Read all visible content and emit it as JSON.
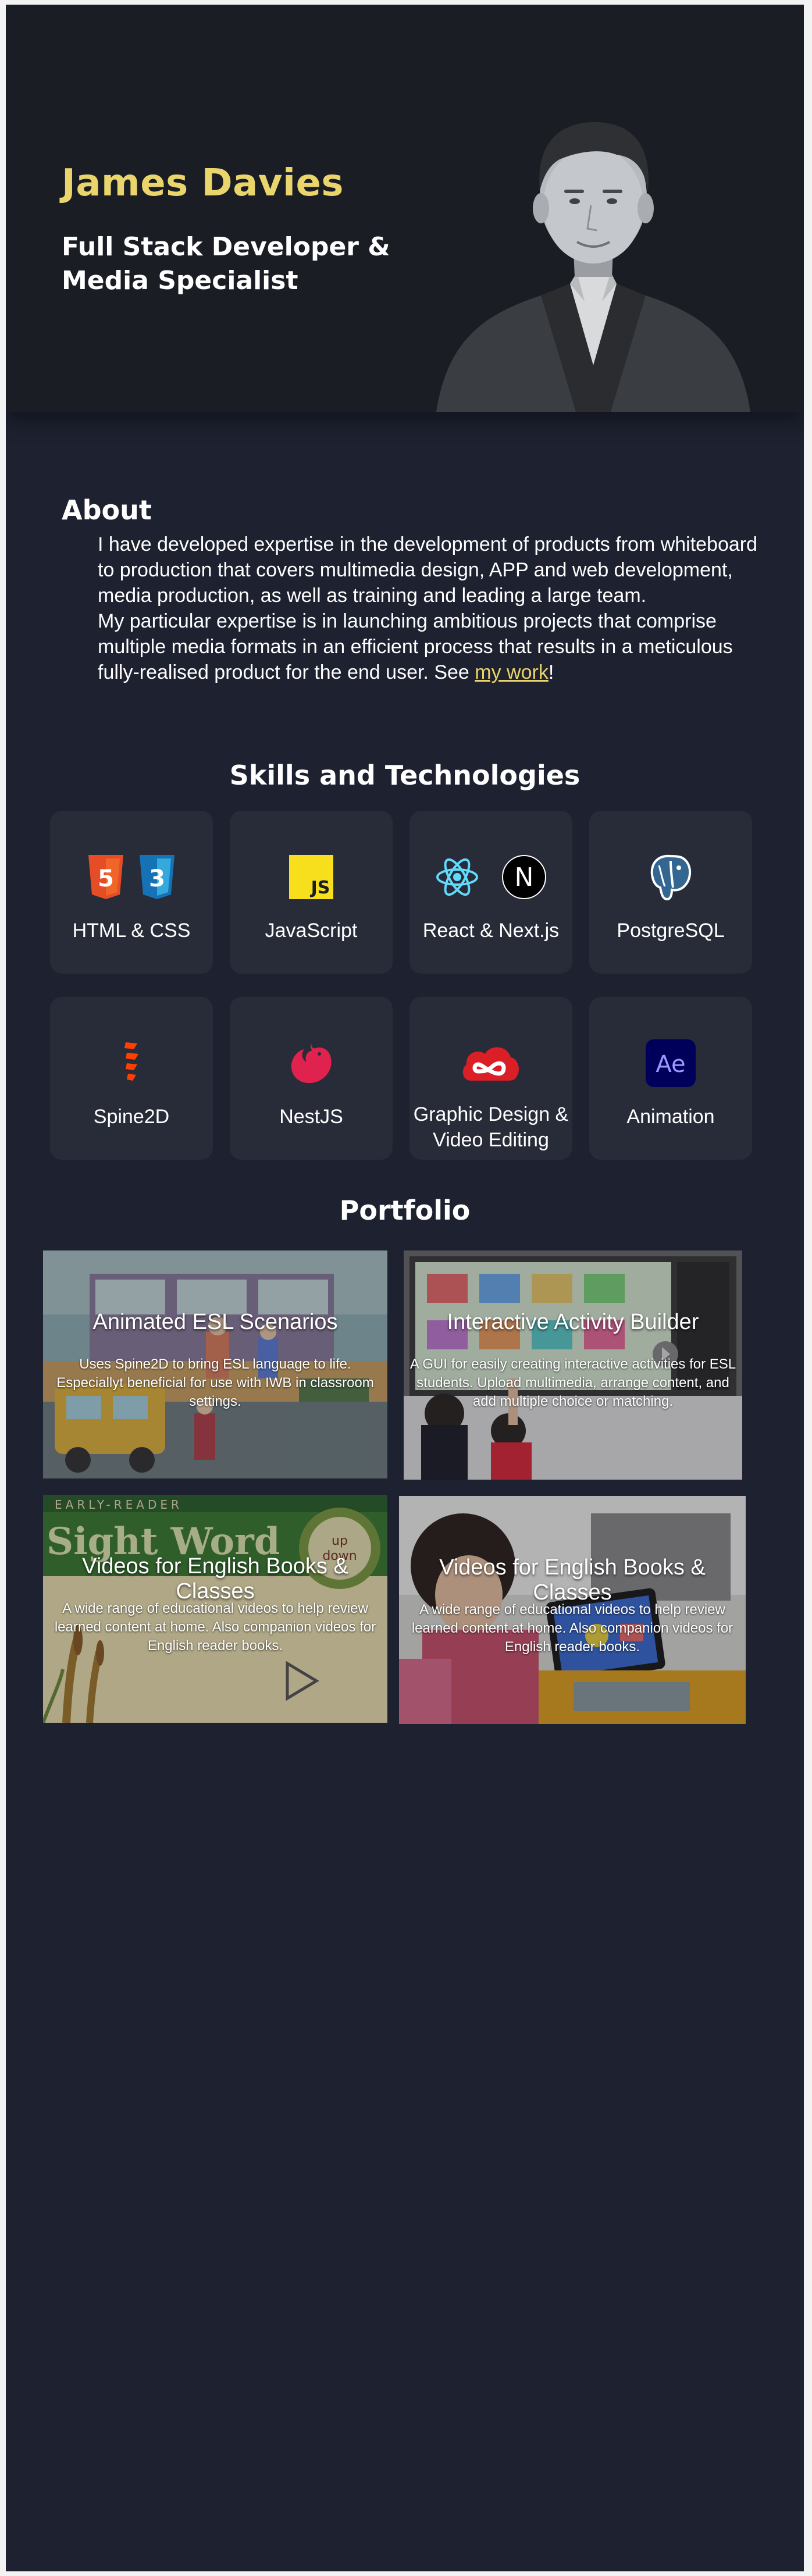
{
  "hero": {
    "name": "James Davies",
    "title": "Full Stack Developer & Media Specialist"
  },
  "about": {
    "heading": "About",
    "paragraph1": "I have developed expertise in the development of products from whiteboard to production that covers multimedia design, APP and web development, media production, as well as training and leading a large team.",
    "paragraph2_before": "My particular expertise is in launching ambitious projects that comprise multiple media formats in an efficient process that results in a meticulous fully-realised product for the end user. See ",
    "link": "my work",
    "paragraph2_after": "!"
  },
  "skills": {
    "heading": "Skills and Technologies",
    "items": [
      {
        "label": "HTML & CSS",
        "icons": [
          "html5-icon",
          "css3-icon"
        ]
      },
      {
        "label": "JavaScript",
        "icons": [
          "javascript-icon"
        ]
      },
      {
        "label": "React & Next.js",
        "icons": [
          "react-icon",
          "nextjs-icon"
        ]
      },
      {
        "label": "PostgreSQL",
        "icons": [
          "postgresql-icon"
        ]
      },
      {
        "label": "Spine2D",
        "icons": [
          "spine2d-icon"
        ]
      },
      {
        "label": "NestJS",
        "icons": [
          "nestjs-icon"
        ]
      },
      {
        "label": "Graphic Design & Video Editing",
        "icons": [
          "creative-cloud-icon"
        ]
      },
      {
        "label": "Animation",
        "icons": [
          "after-effects-icon"
        ]
      }
    ]
  },
  "icon_text": {
    "html": "5",
    "css": "3",
    "js": "JS",
    "next": "N",
    "ae": "Ae"
  },
  "portfolio": {
    "heading": "Portfolio",
    "items": [
      {
        "title": "Animated ESL Scenarios",
        "description": "Uses Spine2D to bring ESL language to life. Especiallyt beneficial for use with IWB in classroom settings."
      },
      {
        "title": "Interactive Activity Builder",
        "description": "A GUI for easily creating interactive activities for ESL students. Upload multimedia, arrange content, and add multiple choice or matching."
      },
      {
        "title": "Videos for English Books & Classes",
        "description": "A wide range of educational videos to help review learned content at home. Also companion videos for English reader books.",
        "image_text": {
          "eyebrow": "EARLY-READER",
          "headline": "Sight Word",
          "badge_top": "up",
          "badge_bottom": "down"
        }
      },
      {
        "title": "Videos for English Books & Classes",
        "description": "A wide range of educational videos to help review learned content at home. Also companion videos for English reader books."
      }
    ]
  },
  "colors": {
    "page_bg": "#1d2130",
    "hero_bg": "#1b1d24",
    "card_bg": "#282c38",
    "accent": "#e9d56b"
  }
}
